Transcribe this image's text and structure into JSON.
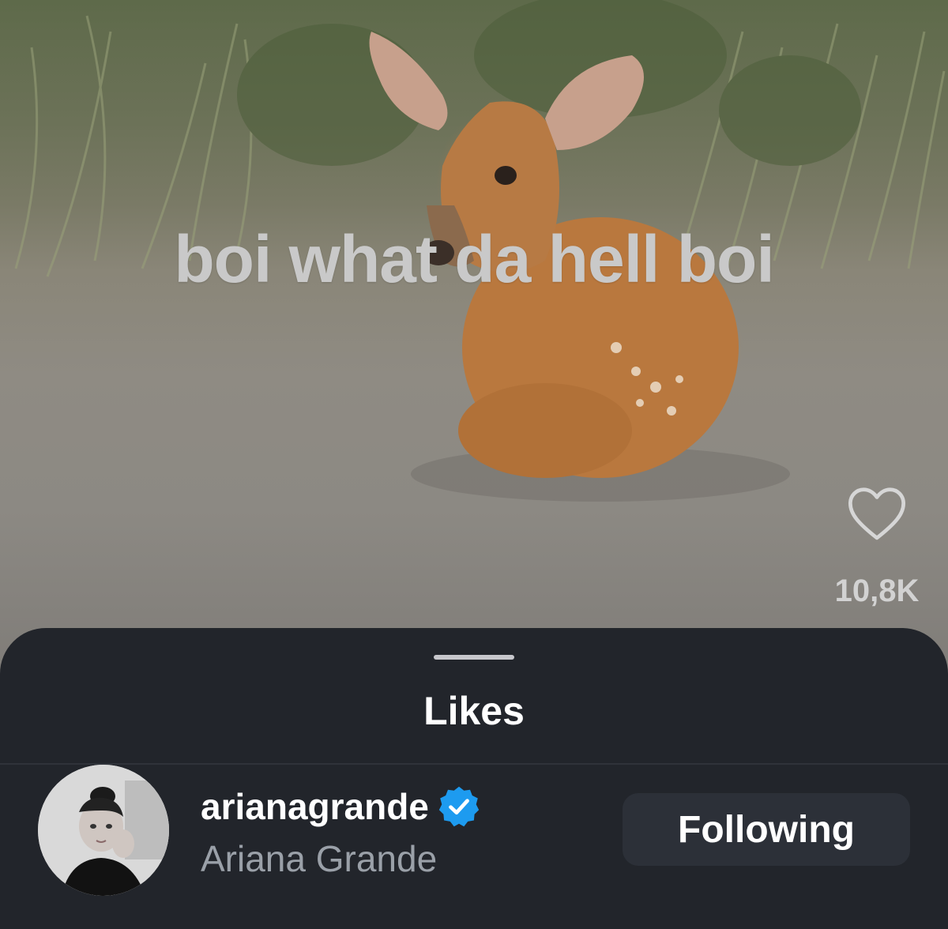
{
  "post": {
    "overlay_caption": "boi what da hell boi",
    "like_icon": "heart-outline-icon",
    "like_count": "10,8K"
  },
  "likes_sheet": {
    "title": "Likes",
    "users": [
      {
        "username": "arianagrande",
        "verified": true,
        "verified_icon": "verified-badge-icon",
        "full_name": "Ariana Grande",
        "follow_label": "Following"
      }
    ]
  },
  "colors": {
    "sheet_background": "#22252b",
    "button_background": "#2c3038",
    "verified_blue": "#1d9bf0",
    "secondary_text": "#9aa0a8"
  }
}
